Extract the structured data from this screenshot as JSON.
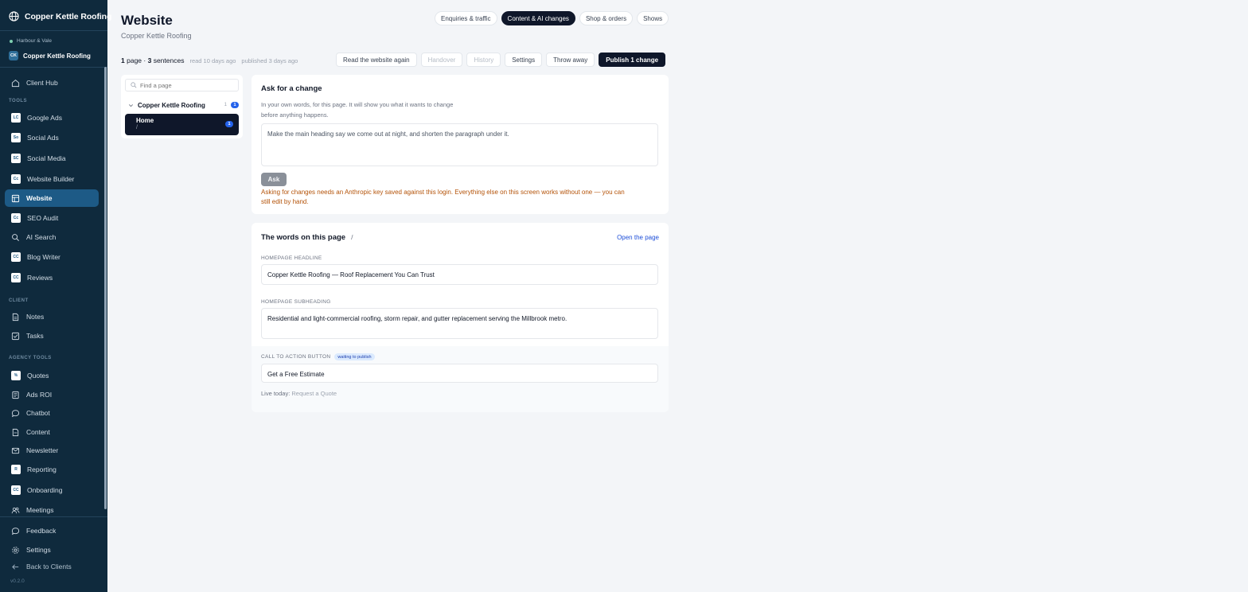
{
  "sidebar": {
    "brand": "Copper Kettle Roofing",
    "agency": "Harbour & Vale",
    "client": {
      "initials": "CK",
      "name": "Copper Kettle Roofing"
    },
    "hub": {
      "label": "Client Hub"
    },
    "sections": {
      "tools": "TOOLS",
      "client": "CLIENT",
      "agency_tools": "AGENCY TOOLS"
    },
    "tools": [
      {
        "label": "Google Ads",
        "icon": "google-ads-icon",
        "glyph": "LC"
      },
      {
        "label": "Social Ads",
        "icon": "social-ads-icon",
        "glyph": "So"
      },
      {
        "label": "Social Media",
        "icon": "social-media-icon",
        "glyph": "SC"
      },
      {
        "label": "Website Builder",
        "icon": "website-builder-icon",
        "glyph": "Cc"
      },
      {
        "label": "Website",
        "icon": "layout-icon",
        "glyph": ""
      },
      {
        "label": "SEO Audit",
        "icon": "seo-audit-icon",
        "glyph": "Cc"
      },
      {
        "label": "AI Search",
        "icon": "search-icon",
        "glyph": ""
      },
      {
        "label": "Blog Writer",
        "icon": "blog-writer-icon",
        "glyph": "CC"
      },
      {
        "label": "Reviews",
        "icon": "reviews-icon",
        "glyph": "CC"
      }
    ],
    "client_items": [
      {
        "label": "Notes",
        "icon": "notes-icon"
      },
      {
        "label": "Tasks",
        "icon": "tasks-icon"
      }
    ],
    "agency_items": [
      {
        "label": "Quotes",
        "icon": "quotes-icon"
      },
      {
        "label": "Ads ROI",
        "icon": "ads-roi-icon"
      },
      {
        "label": "Chatbot",
        "icon": "chatbot-icon"
      },
      {
        "label": "Content",
        "icon": "content-icon"
      },
      {
        "label": "Newsletter",
        "icon": "newsletter-icon"
      },
      {
        "label": "Reporting",
        "icon": "reporting-icon"
      },
      {
        "label": "Onboarding",
        "icon": "onboarding-icon"
      },
      {
        "label": "Meetings",
        "icon": "meetings-icon"
      }
    ],
    "footer": {
      "feedback": "Feedback",
      "settings": "Settings",
      "back": "Back to Clients"
    },
    "version": "v0.2.0",
    "active_item": "Website"
  },
  "header": {
    "title": "Website",
    "subtitle": "Copper Kettle Roofing",
    "tabs": [
      {
        "label": "Enquiries & traffic",
        "active": false
      },
      {
        "label": "Content & AI changes",
        "active": true
      },
      {
        "label": "Shop & orders",
        "active": false
      },
      {
        "label": "Shows",
        "active": false
      }
    ]
  },
  "stats": {
    "pages": "1",
    "pages_label": "page",
    "sentences": "3",
    "sentences_label": "sentences",
    "read": "read 10 days ago",
    "published": "published 3 days ago"
  },
  "actions": {
    "read_again": "Read the website again",
    "handover": "Handover",
    "history": "History",
    "settings": "Settings",
    "throw_away": "Throw away",
    "publish": "Publish 1 change"
  },
  "tree": {
    "search_placeholder": "Find a page",
    "group": {
      "name": "Copper Kettle Roofing",
      "count": "1",
      "changes": "1"
    },
    "page": {
      "name": "Home",
      "path": "/",
      "changes": "1"
    }
  },
  "ask": {
    "title": "Ask for a change",
    "description_1": "In your own words, for this page. It will show you what it wants to change",
    "description_2": "before anything happens.",
    "prompt": "Make the main heading say we come out at night, and shorten the paragraph under it.",
    "button": "Ask",
    "warning_1": "Asking for changes needs an Anthropic key saved against this login. Everything else on this screen works without one — you can",
    "warning_2": "still edit by hand."
  },
  "words": {
    "title": "The words on this page",
    "path": "/",
    "open_link": "Open the page",
    "fields": {
      "headline": {
        "label": "HOMEPAGE HEADLINE",
        "value": "Copper Kettle Roofing — Roof Replacement You Can Trust"
      },
      "subheading": {
        "label": "HOMEPAGE SUBHEADING",
        "value": "Residential and light-commercial roofing, storm repair, and gutter replacement serving the Millbrook metro."
      },
      "cta": {
        "label": "CALL TO ACTION BUTTON",
        "status": "waiting to publish",
        "value": "Get a Free Estimate",
        "live_label": "Live today:",
        "live_value": "Request a Quote"
      }
    }
  },
  "colors": {
    "sidebar_bg": "#0f2a3d",
    "sidebar_active": "#1d5a86",
    "primary_dark": "#0f172a",
    "badge_blue": "#2563eb",
    "warning": "#b45309",
    "link": "#1d4ed8"
  }
}
